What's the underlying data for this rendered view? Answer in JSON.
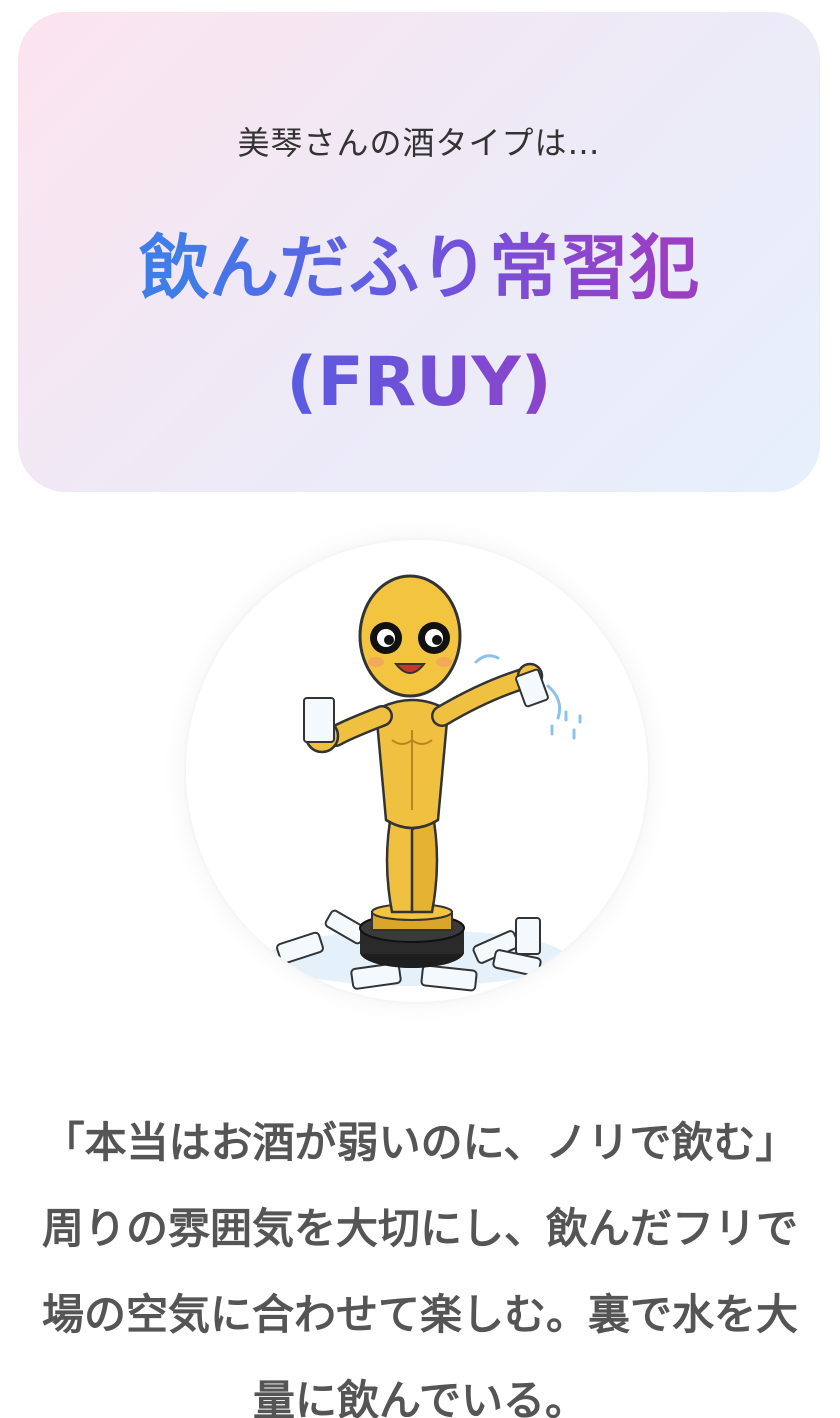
{
  "result": {
    "intro": "美琴さんの酒タイプは…",
    "type_name": "飲んだふり常習犯",
    "type_code": "(FRUY)"
  },
  "illustration": {
    "icon": "trophy-statue-character-illustration"
  },
  "description": "「本当はお酒が弱いのに、ノリで飲む」周りの雰囲気を大切にし、飲んだフリで場の空気に合わせて楽しむ。裏で水を大量に飲んでいる。",
  "colors": {
    "card_gradient_start": "#fce4ee",
    "card_gradient_end": "#e6effc",
    "title_blue": "#3f7de8",
    "title_purple": "#9a3fc4",
    "description_text": "#555555",
    "statue_gold": "#f0c040"
  }
}
